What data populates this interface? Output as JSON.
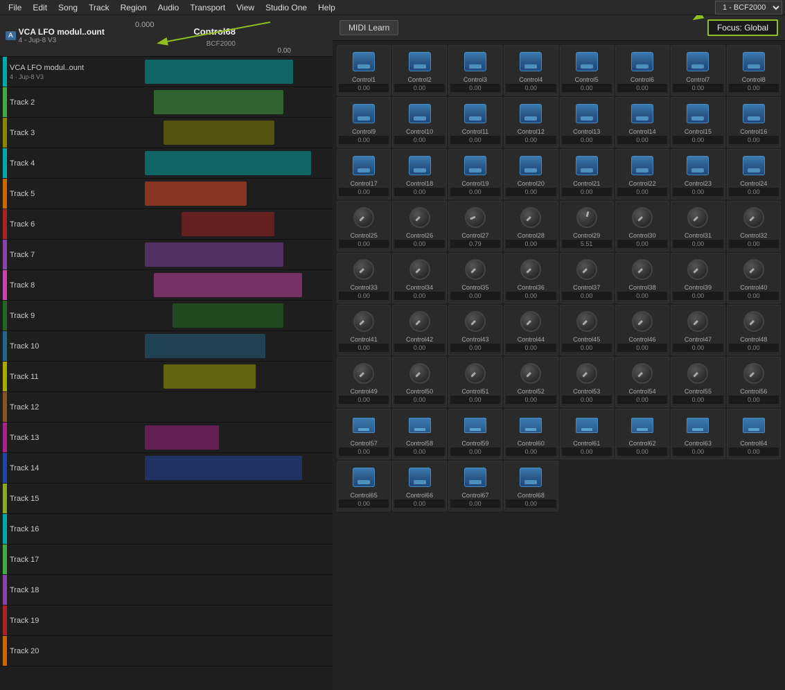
{
  "menubar": {
    "items": [
      "File",
      "Edit",
      "Song",
      "Track",
      "Region",
      "Audio",
      "Transport",
      "View",
      "Studio One",
      "Help"
    ]
  },
  "transport": {
    "device": "1 - BCF2000",
    "track_label": "Track"
  },
  "track_header": {
    "icon": "A",
    "name": "VCA LFO modul..ount",
    "sub": "4 - Jup-8 V3",
    "value_left": "0.000",
    "control_name": "Control68",
    "control_sub": "BCF2000",
    "control_value": "0.00"
  },
  "midi_panel": {
    "learn_button": "MIDI Learn",
    "focus_label": "Focus: Global"
  },
  "controls": [
    {
      "id": 1,
      "name": "Control1",
      "value": "0.00",
      "type": "btn"
    },
    {
      "id": 2,
      "name": "Control2",
      "value": "0.00",
      "type": "btn"
    },
    {
      "id": 3,
      "name": "Control3",
      "value": "0.00",
      "type": "btn"
    },
    {
      "id": 4,
      "name": "Control4",
      "value": "0.00",
      "type": "btn"
    },
    {
      "id": 5,
      "name": "Control5",
      "value": "0.00",
      "type": "btn"
    },
    {
      "id": 6,
      "name": "Control6",
      "value": "0.00",
      "type": "btn"
    },
    {
      "id": 7,
      "name": "Control7",
      "value": "0.00",
      "type": "btn"
    },
    {
      "id": 8,
      "name": "Control8",
      "value": "0.00",
      "type": "btn"
    },
    {
      "id": 9,
      "name": "Control9",
      "value": "0.00",
      "type": "btn"
    },
    {
      "id": 10,
      "name": "Control10",
      "value": "0.00",
      "type": "btn"
    },
    {
      "id": 11,
      "name": "Control11",
      "value": "0.00",
      "type": "btn"
    },
    {
      "id": 12,
      "name": "Control12",
      "value": "0.00",
      "type": "btn"
    },
    {
      "id": 13,
      "name": "Control13",
      "value": "0.00",
      "type": "btn"
    },
    {
      "id": 14,
      "name": "Control14",
      "value": "0.00",
      "type": "btn"
    },
    {
      "id": 15,
      "name": "Control15",
      "value": "0.00",
      "type": "btn"
    },
    {
      "id": 16,
      "name": "Control16",
      "value": "0.00",
      "type": "btn"
    },
    {
      "id": 17,
      "name": "Control17",
      "value": "0.00",
      "type": "btn"
    },
    {
      "id": 18,
      "name": "Control18",
      "value": "0.00",
      "type": "btn"
    },
    {
      "id": 19,
      "name": "Control19",
      "value": "0.00",
      "type": "btn"
    },
    {
      "id": 20,
      "name": "Control20",
      "value": "0.00",
      "type": "btn"
    },
    {
      "id": 21,
      "name": "Control21",
      "value": "0.00",
      "type": "btn"
    },
    {
      "id": 22,
      "name": "Control22",
      "value": "0.00",
      "type": "btn"
    },
    {
      "id": 23,
      "name": "Control23",
      "value": "0.00",
      "type": "btn"
    },
    {
      "id": 24,
      "name": "Control24",
      "value": "0.00",
      "type": "btn"
    },
    {
      "id": 25,
      "name": "Control25",
      "value": "0.00",
      "type": "knob"
    },
    {
      "id": 26,
      "name": "Control26",
      "value": "0.00",
      "type": "knob"
    },
    {
      "id": 27,
      "name": "Control27",
      "value": "0.79",
      "type": "knob"
    },
    {
      "id": 28,
      "name": "Control28",
      "value": "0.00",
      "type": "knob"
    },
    {
      "id": 29,
      "name": "Control29",
      "value": "5.51",
      "type": "knob"
    },
    {
      "id": 30,
      "name": "Control30",
      "value": "0.00",
      "type": "knob"
    },
    {
      "id": 31,
      "name": "Control31",
      "value": "0.00",
      "type": "knob"
    },
    {
      "id": 32,
      "name": "Control32",
      "value": "0.00",
      "type": "knob"
    },
    {
      "id": 33,
      "name": "Control33",
      "value": "0.00",
      "type": "knob"
    },
    {
      "id": 34,
      "name": "Control34",
      "value": "0.00",
      "type": "knob"
    },
    {
      "id": 35,
      "name": "Control35",
      "value": "0.00",
      "type": "knob"
    },
    {
      "id": 36,
      "name": "Control36",
      "value": "0.00",
      "type": "knob"
    },
    {
      "id": 37,
      "name": "Control37",
      "value": "0.00",
      "type": "knob"
    },
    {
      "id": 38,
      "name": "Control38",
      "value": "0.00",
      "type": "knob"
    },
    {
      "id": 39,
      "name": "Control39",
      "value": "0.00",
      "type": "knob"
    },
    {
      "id": 40,
      "name": "Control40",
      "value": "0.00",
      "type": "knob"
    },
    {
      "id": 41,
      "name": "Control41",
      "value": "0.00",
      "type": "knob"
    },
    {
      "id": 42,
      "name": "Control42",
      "value": "0.00",
      "type": "knob"
    },
    {
      "id": 43,
      "name": "Control43",
      "value": "0.00",
      "type": "knob"
    },
    {
      "id": 44,
      "name": "Control44",
      "value": "0.00",
      "type": "knob"
    },
    {
      "id": 45,
      "name": "Control45",
      "value": "0.00",
      "type": "knob"
    },
    {
      "id": 46,
      "name": "Control46",
      "value": "0.00",
      "type": "knob"
    },
    {
      "id": 47,
      "name": "Control47",
      "value": "0.00",
      "type": "knob"
    },
    {
      "id": 48,
      "name": "Control48",
      "value": "0.00",
      "type": "knob"
    },
    {
      "id": 49,
      "name": "Control49",
      "value": "0.00",
      "type": "knob"
    },
    {
      "id": 50,
      "name": "Control50",
      "value": "0.00",
      "type": "knob"
    },
    {
      "id": 51,
      "name": "Control51",
      "value": "0.00",
      "type": "knob"
    },
    {
      "id": 52,
      "name": "Control52",
      "value": "0.00",
      "type": "knob"
    },
    {
      "id": 53,
      "name": "Control53",
      "value": "0.00",
      "type": "knob"
    },
    {
      "id": 54,
      "name": "Control54",
      "value": "0.00",
      "type": "knob"
    },
    {
      "id": 55,
      "name": "Control55",
      "value": "0.00",
      "type": "knob"
    },
    {
      "id": 56,
      "name": "Control56",
      "value": "0.00",
      "type": "knob"
    },
    {
      "id": 57,
      "name": "Control57",
      "value": "0.00",
      "type": "smallbtn"
    },
    {
      "id": 58,
      "name": "Control58",
      "value": "0.00",
      "type": "smallbtn"
    },
    {
      "id": 59,
      "name": "Control59",
      "value": "0.00",
      "type": "smallbtn"
    },
    {
      "id": 60,
      "name": "Control60",
      "value": "0.00",
      "type": "smallbtn"
    },
    {
      "id": 61,
      "name": "Control61",
      "value": "0.00",
      "type": "smallbtn"
    },
    {
      "id": 62,
      "name": "Control62",
      "value": "0.00",
      "type": "smallbtn"
    },
    {
      "id": 63,
      "name": "Control63",
      "value": "0.00",
      "type": "smallbtn"
    },
    {
      "id": 64,
      "name": "Control64",
      "value": "0.00",
      "type": "smallbtn"
    },
    {
      "id": 65,
      "name": "Control65",
      "value": "0.00",
      "type": "btn"
    },
    {
      "id": 66,
      "name": "Control66",
      "value": "0.00",
      "type": "btn"
    },
    {
      "id": 67,
      "name": "Control67",
      "value": "0.00",
      "type": "btn"
    },
    {
      "id": 68,
      "name": "Control68",
      "value": "0.00",
      "type": "btn"
    }
  ],
  "tracks": [
    {
      "name": "...",
      "color": "tr-cyan",
      "level": "0.000"
    },
    {
      "name": "...",
      "color": "tr-green",
      "level": ""
    },
    {
      "name": "...",
      "color": "tr-olive",
      "level": ""
    },
    {
      "name": "...",
      "color": "tr-cyan",
      "level": ""
    },
    {
      "name": "...",
      "color": "tr-orange",
      "level": ""
    },
    {
      "name": "...",
      "color": "tr-red",
      "level": ""
    },
    {
      "name": "...",
      "color": "tr-purple",
      "level": ""
    },
    {
      "name": "...",
      "color": "tr-pink",
      "level": ""
    },
    {
      "name": "...",
      "color": "tr-darkgreen",
      "level": ""
    },
    {
      "name": "...",
      "color": "tr-teal",
      "level": ""
    },
    {
      "name": "...",
      "color": "tr-yellow",
      "level": ""
    },
    {
      "name": "...",
      "color": "tr-brown",
      "level": ""
    },
    {
      "name": "...",
      "color": "tr-magenta",
      "level": ""
    },
    {
      "name": "...",
      "color": "tr-blue",
      "level": ""
    },
    {
      "name": "...",
      "color": "tr-lime",
      "level": ""
    },
    {
      "name": "...",
      "color": "tr-cyan",
      "level": ""
    },
    {
      "name": "...",
      "color": "tr-green",
      "level": ""
    },
    {
      "name": "...",
      "color": "tr-purple",
      "level": ""
    },
    {
      "name": "...",
      "color": "tr-red",
      "level": ""
    },
    {
      "name": "...",
      "color": "tr-orange",
      "level": ""
    }
  ]
}
